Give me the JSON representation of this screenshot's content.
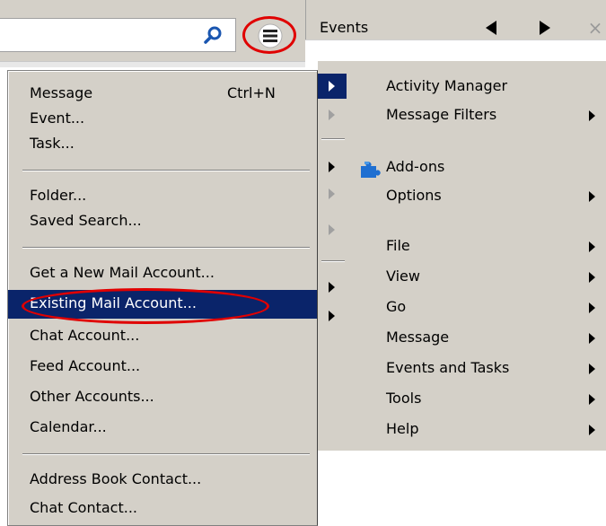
{
  "events_pane": {
    "title": "Events"
  },
  "new_menu": {
    "items": [
      {
        "label": "Message",
        "shortcut": "Ctrl+N"
      },
      {
        "label": "Event..."
      },
      {
        "label": "Task..."
      },
      {
        "label": "Folder..."
      },
      {
        "label": "Saved Search..."
      },
      {
        "label": "Get a New Mail Account..."
      },
      {
        "label": "Existing Mail Account..."
      },
      {
        "label": "Chat Account..."
      },
      {
        "label": "Feed Account..."
      },
      {
        "label": "Other Accounts..."
      },
      {
        "label": "Calendar..."
      },
      {
        "label": "Address Book Contact..."
      },
      {
        "label": "Chat Contact..."
      }
    ]
  },
  "app_menu": {
    "items": [
      {
        "label": "Activity Manager"
      },
      {
        "label": "Message Filters"
      },
      {
        "label": "Add-ons",
        "icon": "puzzle-icon"
      },
      {
        "label": "Options"
      },
      {
        "label": "File"
      },
      {
        "label": "View"
      },
      {
        "label": "Go"
      },
      {
        "label": "Message"
      },
      {
        "label": "Events and Tasks"
      },
      {
        "label": "Tools"
      },
      {
        "label": "Help"
      }
    ]
  },
  "colors": {
    "menu_bg": "#d4d0c8",
    "selection": "#0a246a",
    "highlight_annotation": "#e00000"
  }
}
